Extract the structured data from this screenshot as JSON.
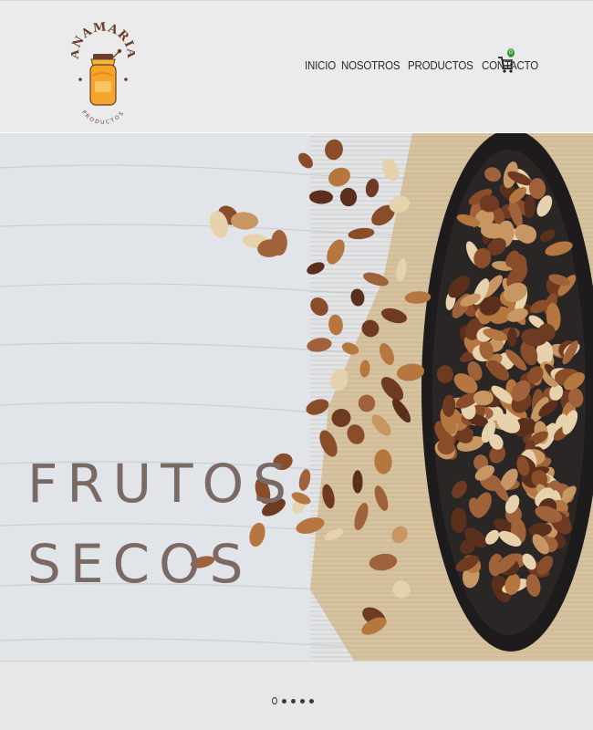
{
  "brand": {
    "name": "ANAMARIA",
    "tagline": "PRODUCTOS"
  },
  "nav": {
    "items": [
      {
        "label": "INICIO"
      },
      {
        "label": "NOSOTROS"
      },
      {
        "label": "PRODUCTOS"
      },
      {
        "label": "CONTACTO"
      }
    ]
  },
  "cart": {
    "icon": "cart-icon",
    "count": "0"
  },
  "hero": {
    "line1": "FRUTOS",
    "line2": "SECOS",
    "title_color": "#7a6a63"
  },
  "slider": {
    "total": 5,
    "active": 1
  },
  "colors": {
    "header_bg": "#ebebeb",
    "badge": "#2e9a3e",
    "wood": "#dfe3e8",
    "burlap": "#d8c5a3",
    "bowl": "#1e1c1d"
  }
}
